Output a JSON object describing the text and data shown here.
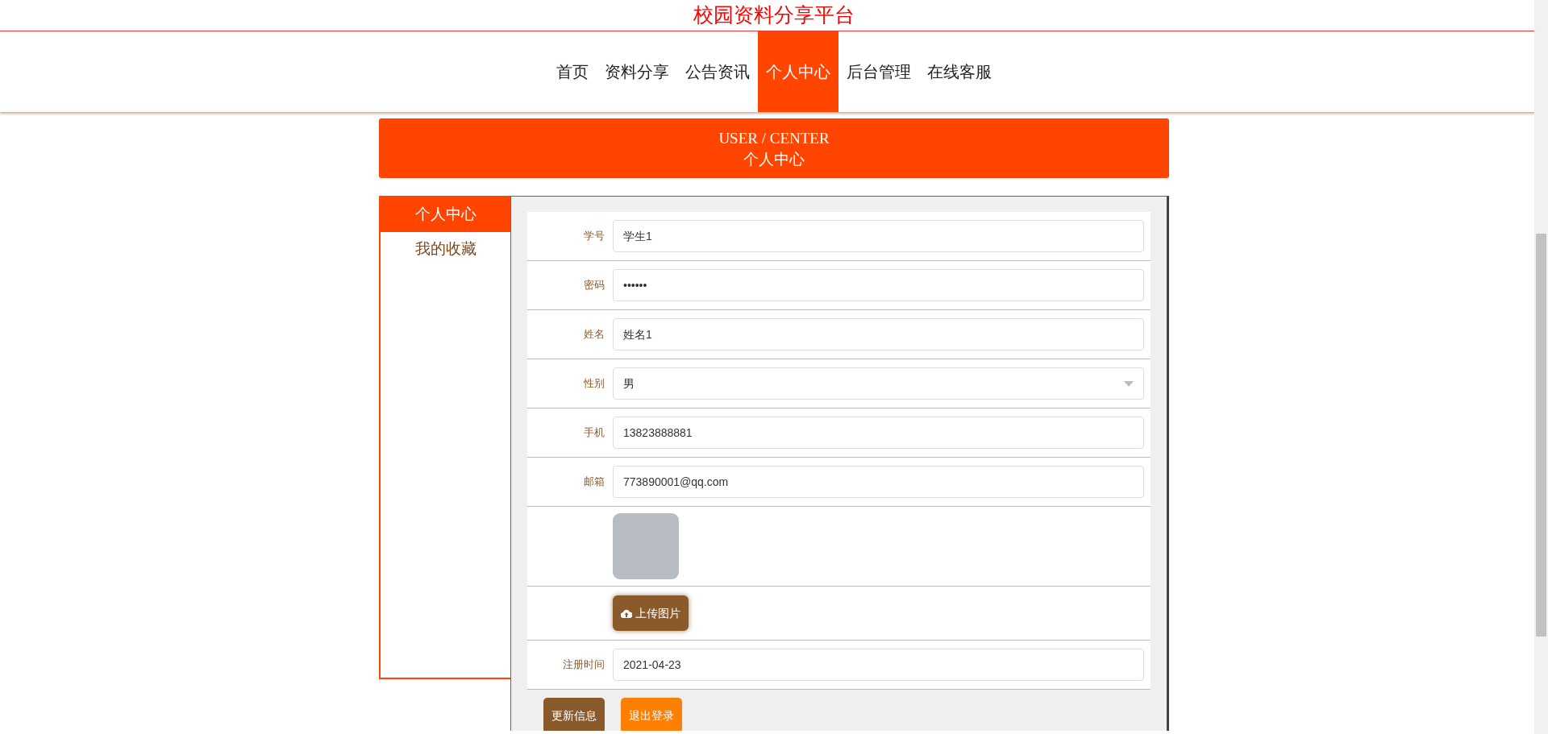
{
  "site_title": "校园资料分享平台",
  "nav": [
    {
      "label": "首页",
      "selected": false
    },
    {
      "label": "资料分享",
      "selected": false
    },
    {
      "label": "公告资讯",
      "selected": false
    },
    {
      "label": "个人中心",
      "selected": true
    },
    {
      "label": "后台管理",
      "selected": false
    },
    {
      "label": "在线客服",
      "selected": false
    }
  ],
  "banner": {
    "title": "USER / CENTER",
    "subtitle": "个人中心"
  },
  "sidebar": {
    "items": [
      {
        "label": "个人中心",
        "selected": true
      },
      {
        "label": "我的收藏",
        "selected": false
      }
    ]
  },
  "form": {
    "rows": [
      {
        "kind": "input",
        "label": "学号",
        "value": "学生1"
      },
      {
        "kind": "input",
        "label": "密码",
        "value": "••••••"
      },
      {
        "kind": "input",
        "label": "姓名",
        "value": "姓名1"
      },
      {
        "kind": "select",
        "label": "性别",
        "value": "男"
      },
      {
        "kind": "input",
        "label": "手机",
        "value": "13823888881"
      },
      {
        "kind": "input",
        "label": "邮箱",
        "value": "773890001@qq.com"
      },
      {
        "kind": "photo"
      },
      {
        "kind": "upload",
        "button": "上传图片"
      },
      {
        "kind": "input",
        "label": "注册时间",
        "value": "2021-04-23"
      }
    ],
    "buttons": [
      {
        "label": "更新信息",
        "kind": "primary"
      },
      {
        "label": "退出登录",
        "kind": "secondary"
      }
    ]
  }
}
